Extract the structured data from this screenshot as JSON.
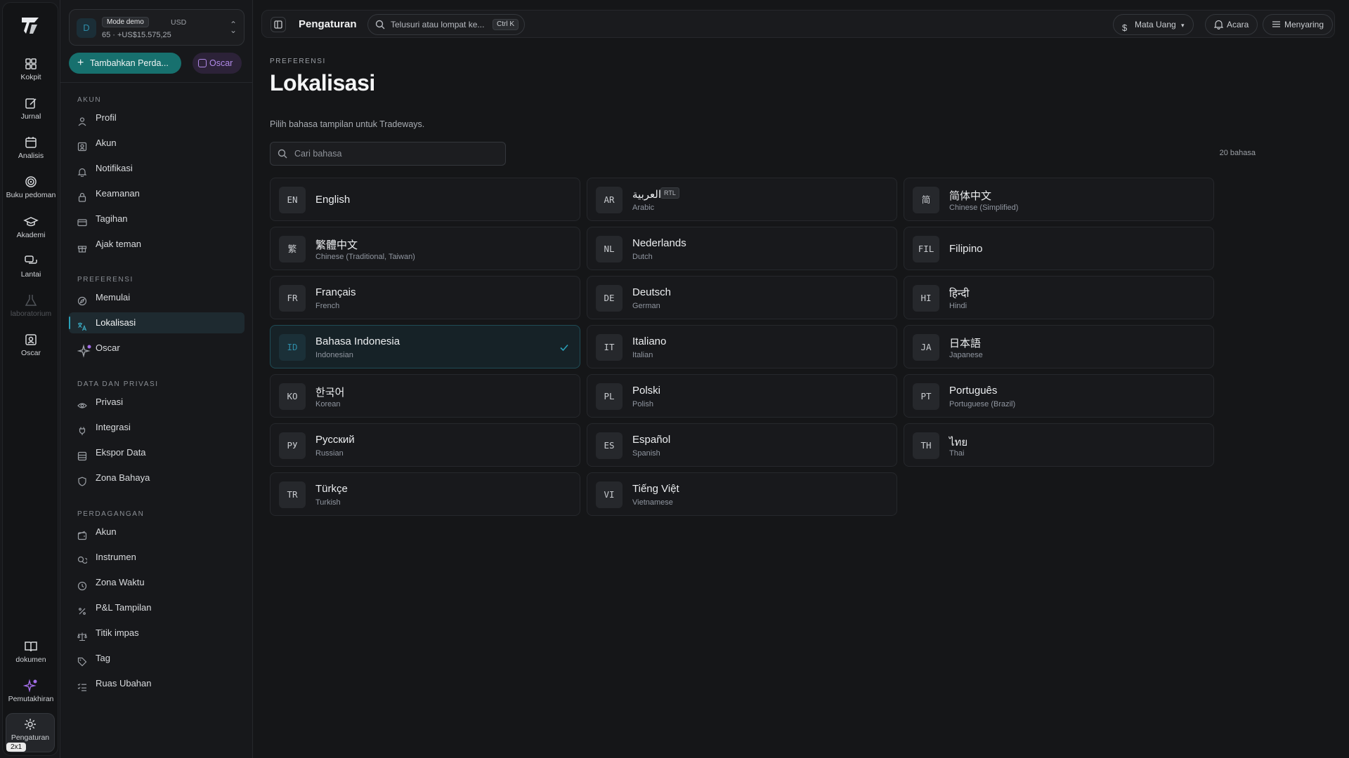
{
  "rail": {
    "items": [
      {
        "label": "Kokpit",
        "icon": "grid-icon"
      },
      {
        "label": "Jurnal",
        "icon": "edit-icon"
      },
      {
        "label": "Analisis",
        "icon": "calendar-icon"
      },
      {
        "label": "Buku pedoman",
        "icon": "target-icon"
      },
      {
        "label": "Akademi",
        "icon": "graduation-cap-icon"
      },
      {
        "label": "Lantai",
        "icon": "chat-icon"
      },
      {
        "label": "laboratorium",
        "icon": "flask-icon"
      },
      {
        "label": "Oscar",
        "icon": "person-badge-icon"
      }
    ],
    "bottom": [
      {
        "label": "dokumen",
        "icon": "book-icon"
      },
      {
        "label": "Pemutakhiran",
        "icon": "sparkle-icon"
      },
      {
        "label": "Pengaturan",
        "icon": "gear-icon"
      }
    ],
    "tag": "2x1"
  },
  "account": {
    "avatar": "D",
    "mode": "Mode demo",
    "currency": "USD",
    "balance": "65 · +US$15.575,25"
  },
  "sidebar": {
    "add_label": "Tambahkan Perda...",
    "oscar_label": "Oscar",
    "sections": [
      {
        "title": "AKUN",
        "items": [
          {
            "label": "Profil",
            "icon": "user-icon"
          },
          {
            "label": "Akun",
            "icon": "id-card-icon"
          },
          {
            "label": "Notifikasi",
            "icon": "bell-icon"
          },
          {
            "label": "Keamanan",
            "icon": "lock-icon"
          },
          {
            "label": "Tagihan",
            "icon": "credit-card-icon"
          },
          {
            "label": "Ajak teman",
            "icon": "gift-icon"
          }
        ]
      },
      {
        "title": "PREFERENSI",
        "items": [
          {
            "label": "Memulai",
            "icon": "compass-icon"
          },
          {
            "label": "Lokalisasi",
            "icon": "translate-icon",
            "active": true
          },
          {
            "label": "Oscar",
            "icon": "sparkle-icon"
          }
        ]
      },
      {
        "title": "DATA DAN PRIVASI",
        "items": [
          {
            "label": "Privasi",
            "icon": "eye-icon"
          },
          {
            "label": "Integrasi",
            "icon": "plug-icon"
          },
          {
            "label": "Ekspor Data",
            "icon": "database-icon"
          },
          {
            "label": "Zona Bahaya",
            "icon": "shield-icon"
          }
        ]
      },
      {
        "title": "PERDAGANGAN",
        "items": [
          {
            "label": "Akun",
            "icon": "wallet-icon"
          },
          {
            "label": "Instrumen",
            "icon": "coins-icon"
          },
          {
            "label": "Zona Waktu",
            "icon": "clock-icon"
          },
          {
            "label": "P&L Tampilan",
            "icon": "percent-icon"
          },
          {
            "label": "Titik impas",
            "icon": "scale-icon"
          },
          {
            "label": "Tag",
            "icon": "tag-icon"
          },
          {
            "label": "Ruas Ubahan",
            "icon": "list-check-icon"
          }
        ]
      }
    ]
  },
  "topbar": {
    "title": "Pengaturan",
    "search_placeholder": "Telusuri atau lompat ke...",
    "search_shortcut": "Ctrl K",
    "currency_label": "Mata Uang",
    "events_label": "Acara",
    "filter_label": "Menyaring"
  },
  "page": {
    "eyebrow": "PREFERENSI",
    "title": "Lokalisasi",
    "description": "Pilih bahasa tampilan untuk Tradeways.",
    "search_placeholder": "Cari bahasa",
    "count": "20 bahasa"
  },
  "languages": [
    {
      "code": "EN",
      "name": "English",
      "sub": ""
    },
    {
      "code": "AR",
      "name": "العربية",
      "sub": "Arabic",
      "badge": "RTL"
    },
    {
      "code": "简",
      "name": "简体中文",
      "sub": "Chinese (Simplified)"
    },
    {
      "code": "繁",
      "name": "繁體中文",
      "sub": "Chinese (Traditional, Taiwan)"
    },
    {
      "code": "NL",
      "name": "Nederlands",
      "sub": "Dutch"
    },
    {
      "code": "FIL",
      "name": "Filipino",
      "sub": ""
    },
    {
      "code": "FR",
      "name": "Français",
      "sub": "French"
    },
    {
      "code": "DE",
      "name": "Deutsch",
      "sub": "German"
    },
    {
      "code": "HI",
      "name": "हिन्दी",
      "sub": "Hindi"
    },
    {
      "code": "ID",
      "name": "Bahasa Indonesia",
      "sub": "Indonesian",
      "selected": true
    },
    {
      "code": "IT",
      "name": "Italiano",
      "sub": "Italian"
    },
    {
      "code": "JA",
      "name": "日本語",
      "sub": "Japanese"
    },
    {
      "code": "KO",
      "name": "한국어",
      "sub": "Korean"
    },
    {
      "code": "PL",
      "name": "Polski",
      "sub": "Polish"
    },
    {
      "code": "PT",
      "name": "Português",
      "sub": "Portuguese (Brazil)"
    },
    {
      "code": "РУ",
      "name": "Русский",
      "sub": "Russian"
    },
    {
      "code": "ES",
      "name": "Español",
      "sub": "Spanish"
    },
    {
      "code": "TH",
      "name": "ไทย",
      "sub": "Thai"
    },
    {
      "code": "TR",
      "name": "Türkçe",
      "sub": "Turkish"
    },
    {
      "code": "VI",
      "name": "Tiếng Việt",
      "sub": "Vietnamese"
    }
  ],
  "colors": {
    "accent": "#2aa0b8",
    "primary_button": "#17706e",
    "oscar": "#b18ae8"
  }
}
